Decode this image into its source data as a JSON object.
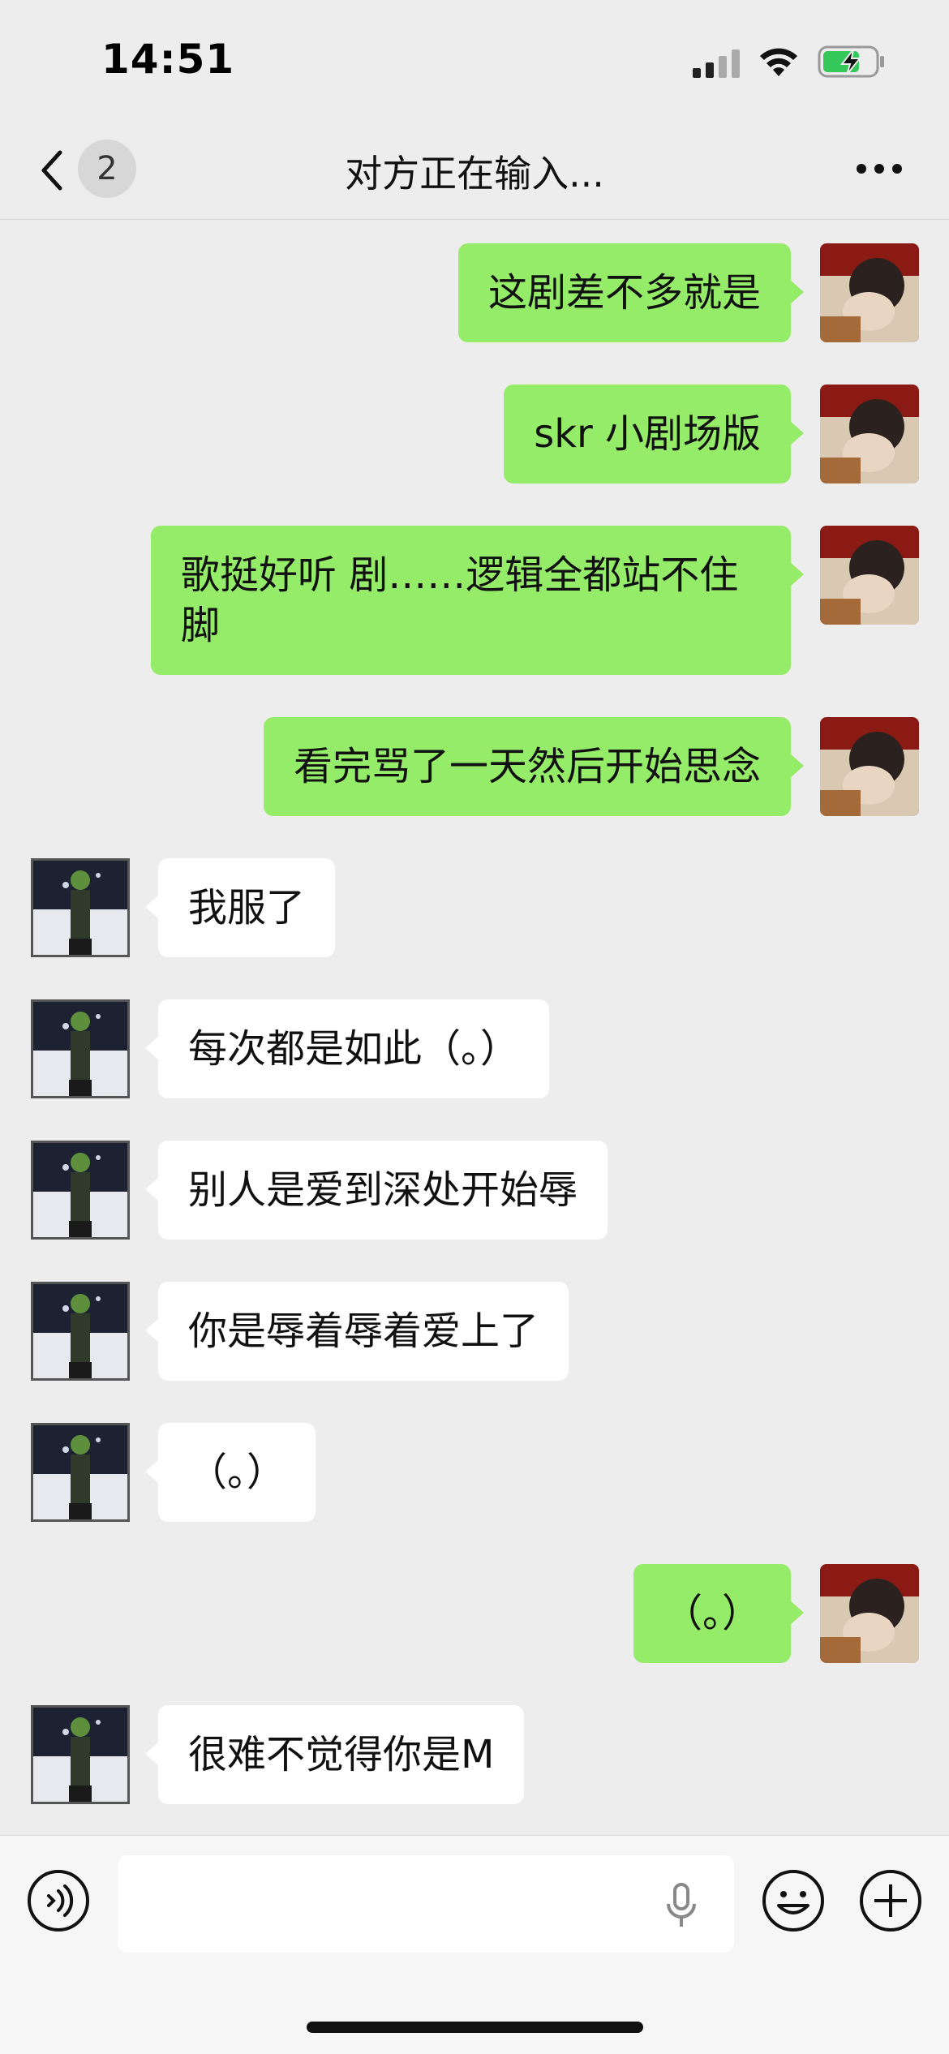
{
  "status_bar": {
    "time": "14:51"
  },
  "header": {
    "back_icon": "chevron-left-icon",
    "unread_count": "2",
    "title": "对方正在输入...",
    "more_icon": "more-dots-icon"
  },
  "messages": [
    {
      "sender": "self",
      "text": "这剧差不多就是"
    },
    {
      "sender": "self",
      "text": "skr 小剧场版"
    },
    {
      "sender": "self",
      "text": "歌挺好听 剧……逻辑全都站不住脚"
    },
    {
      "sender": "self",
      "text": "看完骂了一天然后开始思念"
    },
    {
      "sender": "other",
      "text": "我服了"
    },
    {
      "sender": "other",
      "text": "每次都是如此（。）"
    },
    {
      "sender": "other",
      "text": "别人是爱到深处开始辱"
    },
    {
      "sender": "other",
      "text": "你是辱着辱着爱上了"
    },
    {
      "sender": "other",
      "text": "（。）"
    },
    {
      "sender": "self",
      "text": "（。）"
    },
    {
      "sender": "other",
      "text": "很难不觉得你是M"
    }
  ],
  "input_bar": {
    "value": "",
    "voice_icon": "voice-icon",
    "mic_icon": "mic-icon",
    "emoji_icon": "emoji-icon",
    "plus_icon": "plus-icon"
  },
  "colors": {
    "self_bubble": "#95ec69",
    "other_bubble": "#ffffff",
    "background": "#ededed"
  }
}
